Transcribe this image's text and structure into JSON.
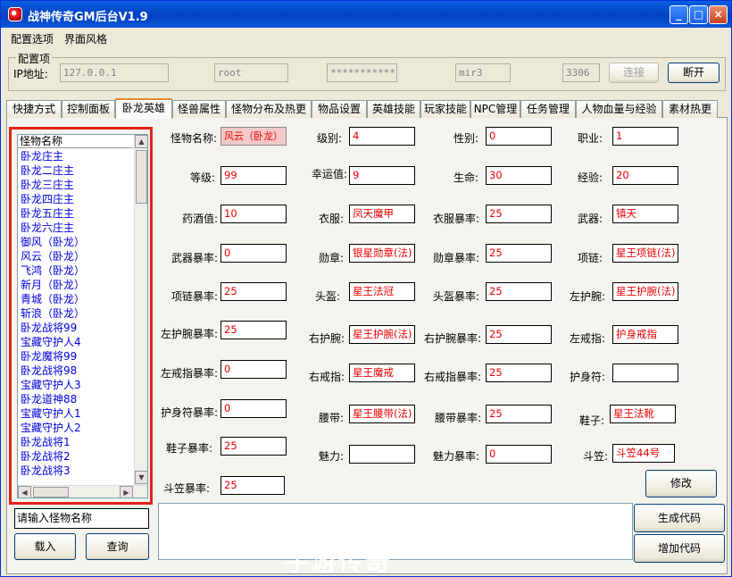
{
  "window": {
    "title": "战神传奇GM后台V1.9",
    "min_icon": "_",
    "max_icon": "□",
    "close_icon": "×"
  },
  "menu": [
    "配置选项",
    "界面风格"
  ],
  "config": {
    "group_title": "配置项",
    "ip_label": "IP地址:",
    "ip_value": "127.0.0.1",
    "user_value": "root",
    "password_value": "************",
    "db_value": "mir3",
    "port_value": "3306",
    "connect_label": "连接",
    "disconnect_label": "断开"
  },
  "tabs": [
    "快捷方式",
    "控制面板",
    "卧龙英雄",
    "怪兽属性",
    "怪物分布及热更",
    "物品设置",
    "英雄技能",
    "玩家技能",
    "NPC管理",
    "任务管理",
    "人物血量与经验",
    "素材热更"
  ],
  "active_tab": "卧龙英雄",
  "monster_list": {
    "header": "怪物名称",
    "items": [
      "卧龙庄主",
      "卧龙二庄主",
      "卧龙三庄主",
      "卧龙四庄主",
      "卧龙五庄主",
      "卧龙六庄主",
      "御风（卧龙）",
      "风云（卧龙）",
      "飞鸿（卧龙）",
      "新月（卧龙）",
      "青城（卧龙）",
      "斩浪（卧龙）",
      "卧龙战将99",
      "宝藏守护人4",
      "卧龙魔将99",
      "卧龙战将98",
      "宝藏守护人3",
      "卧龙道神88",
      "宝藏守护人1",
      "宝藏守护人2",
      "卧龙战将1",
      "卧龙战将2",
      "卧龙战将3"
    ],
    "scroll_up": "▲",
    "scroll_down": "▼",
    "scroll_left": "◀",
    "scroll_right": "▶"
  },
  "search_placeholder": "请输入怪物名称",
  "buttons": {
    "load": "载入",
    "query": "查询",
    "modify": "修改",
    "generate": "生成代码",
    "add": "增加代码"
  },
  "fields": {
    "name": {
      "label": "怪物名称:",
      "value": "风云（卧龙）"
    },
    "level_tier": {
      "label": "级别:",
      "value": "4"
    },
    "gender": {
      "label": "性别:",
      "value": "0"
    },
    "job": {
      "label": "职业:",
      "value": "1"
    },
    "level": {
      "label": "等级:",
      "value": "99"
    },
    "luck": {
      "label": "幸运值:",
      "value": "9"
    },
    "hp": {
      "label": "生命:",
      "value": "30"
    },
    "exp": {
      "label": "经验:",
      "value": "20"
    },
    "potion": {
      "label": "药酒值:",
      "value": "10"
    },
    "clothes": {
      "label": "衣服:",
      "value": "凤天魔甲"
    },
    "clothes_rate": {
      "label": "衣服暴率:",
      "value": "25"
    },
    "weapon": {
      "label": "武器:",
      "value": "镇天"
    },
    "weapon_rate": {
      "label": "武器暴率:",
      "value": "0"
    },
    "medal": {
      "label": "勋章:",
      "value": "银星勋章(法)"
    },
    "medal_rate": {
      "label": "勋章暴率:",
      "value": "25"
    },
    "necklace": {
      "label": "项链:",
      "value": "星王项链(法)"
    },
    "necklace_rate": {
      "label": "项链暴率:",
      "value": "25"
    },
    "helmet": {
      "label": "头盔:",
      "value": "星王法冠"
    },
    "helmet_rate": {
      "label": "头盔暴率:",
      "value": "25"
    },
    "left_bracelet": {
      "label": "左护腕:",
      "value": "星王护腕(法)"
    },
    "left_bracelet_rate": {
      "label": "左护腕暴率:",
      "value": "25"
    },
    "right_bracelet": {
      "label": "右护腕:",
      "value": "星王护腕(法)"
    },
    "right_bracelet_rate": {
      "label": "右护腕暴率:",
      "value": "25"
    },
    "left_ring": {
      "label": "左戒指:",
      "value": "护身戒指"
    },
    "left_ring_rate": {
      "label": "左戒指暴率:",
      "value": "0"
    },
    "right_ring": {
      "label": "右戒指:",
      "value": "星王魔戒"
    },
    "right_ring_rate": {
      "label": "右戒指暴率:",
      "value": "25"
    },
    "amulet": {
      "label": "护身符:",
      "value": ""
    },
    "amulet_rate": {
      "label": "护身符暴率:",
      "value": "0"
    },
    "belt": {
      "label": "腰带:",
      "value": "星王腰带(法)"
    },
    "belt_rate": {
      "label": "腰带暴率:",
      "value": "25"
    },
    "shoes": {
      "label": "鞋子:",
      "value": "星王法靴"
    },
    "shoes_rate": {
      "label": "鞋子暴率:",
      "value": "25"
    },
    "charm": {
      "label": "魅力:",
      "value": ""
    },
    "charm_rate": {
      "label": "魅力暴率:",
      "value": "0"
    },
    "hat": {
      "label": "斗笠:",
      "value": "斗笠44号"
    },
    "hat_rate": {
      "label": "斗笠暴率:",
      "value": "25"
    }
  },
  "watermark": "手游传奇"
}
